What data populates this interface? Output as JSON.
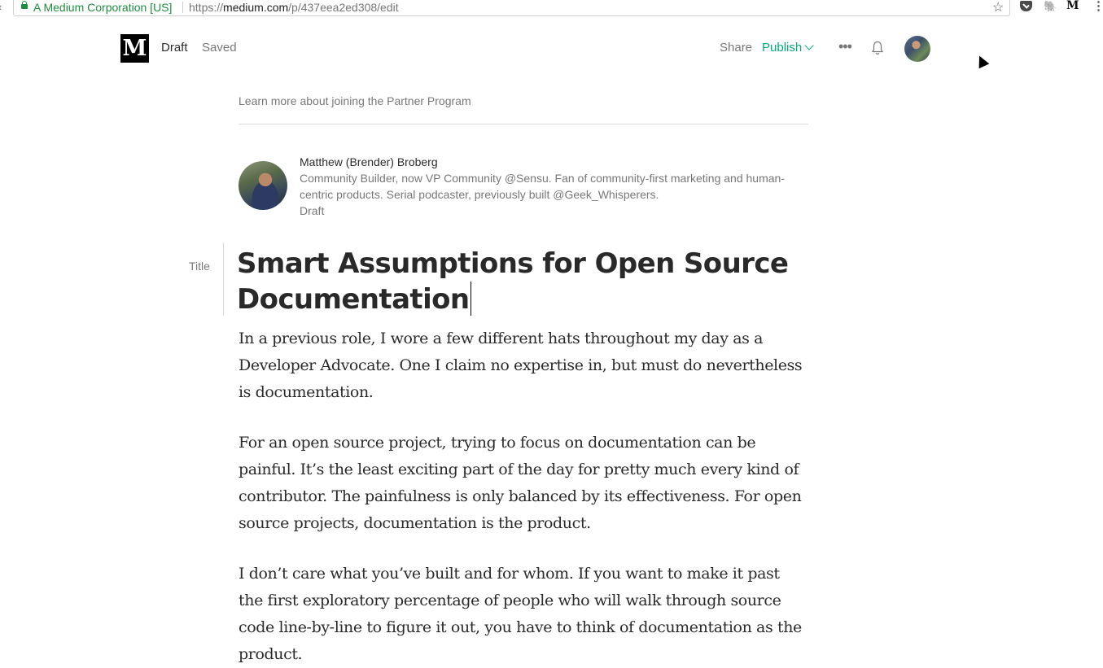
{
  "browser": {
    "site_name": "A Medium Corporation [US]",
    "url_scheme": "https://",
    "url_host": "medium.com",
    "url_path": "/p/437eea2ed308/edit"
  },
  "header": {
    "logo_letter": "M",
    "status": "Draft",
    "saved": "Saved",
    "share_label": "Share",
    "publish_label": "Publish",
    "more_label": "•••"
  },
  "partner_link": "Learn more about joining the Partner Program",
  "author": {
    "name": "Matthew (Brender) Broberg",
    "bio": "Community Builder, now VP Community @Sensu. Fan of community-first marketing and human-centric products. Serial podcaster, previously built @Geek_Whisperers.",
    "status": "Draft"
  },
  "editor": {
    "title_label": "Title",
    "title": "Smart Assumptions for Open Source Documentation",
    "paragraphs": [
      "In a previous role, I wore a few different hats throughout my day as a Developer Advocate. One I claim no expertise in, but must do nevertheless is documentation.",
      "For an open source project, trying to focus on documentation can be painful. It’s the least exciting part of the day for pretty much every kind of contributor. The painfulness is only balanced by its effectiveness. For open source projects, documentation is the product.",
      "I don’t care what you’ve built and for whom. If you want to make it past the first exploratory percentage of people who will walk through source code line-by-line to figure it out, you have to think of documentation as the product."
    ]
  },
  "colors": {
    "accent": "#03a87c",
    "secure": "#1e8e3e"
  }
}
